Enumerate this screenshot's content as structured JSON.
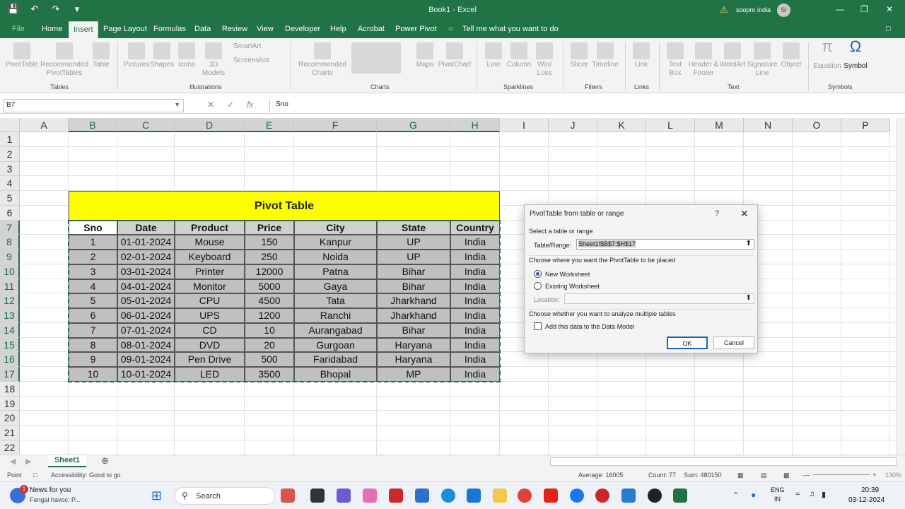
{
  "window": {
    "title": "Book1  -  Excel",
    "user": "soopro india",
    "avatar": "SI"
  },
  "tabs": [
    "File",
    "Home",
    "Insert",
    "Page Layout",
    "Formulas",
    "Data",
    "Review",
    "View",
    "Developer",
    "Help",
    "Acrobat",
    "Power Pivot",
    "Tell me what you want to do"
  ],
  "active_tab": "Insert",
  "ribbon": {
    "pivottable": "PivotTable",
    "recommended_pivottables": "Recommended PivotTables",
    "table": "Table",
    "group_tables": "Tables",
    "pictures": "Pictures",
    "shapes": "Shapes",
    "icons": "Icons",
    "models3d": "3D Models",
    "smartart": "SmartArt",
    "screenshot": "Screenshot",
    "group_illustrations": "Illustrations",
    "recommended_charts": "Recommended Charts",
    "maps": "Maps",
    "pivotchart": "PivotChart",
    "group_charts": "Charts",
    "line": "Line",
    "column": "Column",
    "winloss": "Win/ Loss",
    "group_sparklines": "Sparklines",
    "slicer": "Slicer",
    "timeline": "Timeline",
    "group_filters": "Filters",
    "link": "Link",
    "group_links": "Links",
    "textbox": "Text Box",
    "header_footer": "Header & Footer",
    "wordart": "WordArt",
    "signature_line": "Signature Line",
    "object": "Object",
    "group_text": "Text",
    "equation": "Equation",
    "symbol": "Symbol",
    "group_symbols": "Symbols"
  },
  "formula_bar": {
    "name_box": "B7",
    "content": "Sno"
  },
  "columns": [
    "A",
    "B",
    "C",
    "D",
    "E",
    "F",
    "G",
    "H",
    "I",
    "J",
    "K",
    "L",
    "M",
    "N",
    "O",
    "P"
  ],
  "rows": [
    "1",
    "2",
    "3",
    "4",
    "5",
    "6",
    "7",
    "8",
    "9",
    "10",
    "11",
    "12",
    "13",
    "14",
    "15",
    "16",
    "17",
    "18",
    "19",
    "20",
    "21",
    "22"
  ],
  "table": {
    "title": "Pivot Table",
    "headers": [
      "Sno",
      "Date",
      "Product",
      "Price",
      "City",
      "State",
      "Country"
    ],
    "rows": [
      [
        "1",
        "01-01-2024",
        "Mouse",
        "150",
        "Kanpur",
        "UP",
        "India"
      ],
      [
        "2",
        "02-01-2024",
        "Keyboard",
        "250",
        "Noida",
        "UP",
        "India"
      ],
      [
        "3",
        "03-01-2024",
        "Printer",
        "12000",
        "Patna",
        "Bihar",
        "India"
      ],
      [
        "4",
        "04-01-2024",
        "Monitor",
        "5000",
        "Gaya",
        "Bihar",
        "India"
      ],
      [
        "5",
        "05-01-2024",
        "CPU",
        "4500",
        "Tata",
        "Jharkhand",
        "India"
      ],
      [
        "6",
        "06-01-2024",
        "UPS",
        "1200",
        "Ranchi",
        "Jharkhand",
        "India"
      ],
      [
        "7",
        "07-01-2024",
        "CD",
        "10",
        "Aurangabad",
        "Bihar",
        "India"
      ],
      [
        "8",
        "08-01-2024",
        "DVD",
        "20",
        "Gurgoan",
        "Haryana",
        "India"
      ],
      [
        "9",
        "09-01-2024",
        "Pen Drive",
        "500",
        "Faridabad",
        "Haryana",
        "India"
      ],
      [
        "10",
        "10-01-2024",
        "LED",
        "3500",
        "Bhopal",
        "MP",
        "India"
      ]
    ]
  },
  "dialog": {
    "title": "PivotTable from table or range",
    "help": "?",
    "select_label": "Select a table or range",
    "range_label": "Table/Range:",
    "range_value": "Sheet1!$B$7:$H$17",
    "place_label": "Choose where you want the PivotTable to be placed",
    "new_ws": "New Worksheet",
    "existing_ws": "Existing Worksheet",
    "location_label": "Location:",
    "location_value": "",
    "multi_label": "Choose whether you want to analyze multiple tables",
    "data_model": "Add this data to the Data Model",
    "ok": "OK",
    "cancel": "Cancel",
    "new_ws_selected": true,
    "data_model_checked": false
  },
  "sheet_tab": "Sheet1",
  "status": {
    "mode": "Point",
    "accessibility": "Accessibility: Good to go",
    "average": "Average: 16005",
    "count": "Count: 77",
    "sum": "Sum: 480150",
    "zoom": "130%"
  },
  "taskbar": {
    "news_title": "News for you",
    "news_sub": "Fengal havoc: P...",
    "news_badge": "1",
    "search": "Search",
    "lang1": "ENG",
    "lang2": "IN",
    "time": "20:39",
    "date": "03-12-2024"
  }
}
